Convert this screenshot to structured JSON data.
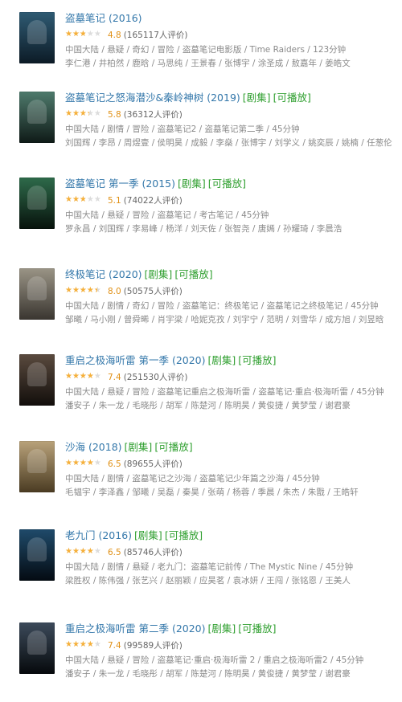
{
  "colors": {
    "link": "#3377aa",
    "tag_green": "#2f9f2f",
    "star": "#f6b03a",
    "score": "#e09015",
    "meta": "#8a8a8a"
  },
  "items": [
    {
      "title": "盗墓笔记 (2016)",
      "tags": [],
      "rating": 4.8,
      "votes": "(165117人评价)",
      "genres": "中国大陆 / 悬疑 / 奇幻 / 冒险 / 盗墓笔记电影版 / Time Raiders / 123分钟",
      "cast": "李仁港 / 井柏然 / 鹿晗 / 马思纯 / 王景春 / 张博宇 / 涂圣成 / 敖嘉年 / 姜皓文",
      "poster_colors": [
        "#2f5b73",
        "#0c1b26"
      ]
    },
    {
      "title": "盗墓笔记之怒海潜沙&秦岭神树 (2019)",
      "tags": [
        "[剧集]",
        "[可播放]"
      ],
      "rating": 5.8,
      "votes": "(36312人评价)",
      "genres": "中国大陆 / 剧情 / 冒险 / 盗墓笔记2 / 盗墓笔记第二季 / 45分钟",
      "cast": "刘国辉 / 李昂 / 周煜壹 / 侯明昊 / 成毅 / 李燊 / 张博宇 / 刘学义 / 姚奕辰 / 姚楠 / 任葱伦",
      "poster_colors": [
        "#4e7a6c",
        "#0f1a17"
      ]
    },
    {
      "title": "盗墓笔记 第一季 (2015)",
      "tags": [
        "[剧集]",
        "[可播放]"
      ],
      "rating": 5.1,
      "votes": "(74022人评价)",
      "genres": "中国大陆 / 悬疑 / 冒险 / 盗墓笔记 / 考古笔记 / 45分钟",
      "cast": "罗永昌 / 刘国辉 / 李易峰 / 杨洋 / 刘天佐 / 张智尧 / 唐嫣 / 孙耀琦 / 李晨浩",
      "poster_colors": [
        "#2e6a4a",
        "#07120c"
      ]
    },
    {
      "title": "终极笔记 (2020)",
      "tags": [
        "[剧集]",
        "[可播放]"
      ],
      "rating": 8.0,
      "votes": "(50575人评价)",
      "genres": "中国大陆 / 剧情 / 奇幻 / 冒险 / 盗墓笔记：终极笔记 / 盗墓笔记之终极笔记 / 45分钟",
      "cast": "邹曦 / 马小刚 / 曾舜晞 / 肖宇梁 / 哈妮克孜 / 刘宇宁 / 范明 / 刘雪华 / 成方旭 / 刘昱晗",
      "poster_colors": [
        "#9a9486",
        "#3a3630"
      ]
    },
    {
      "title": "重启之极海听雷 第一季 (2020)",
      "tags": [
        "[剧集]",
        "[可播放]"
      ],
      "rating": 7.4,
      "votes": "(251530人评价)",
      "genres": "中国大陆 / 悬疑 / 冒险 / 盗墓笔记重启之极海听雷 / 盗墓笔记·重启·极海听雷 / 45分钟",
      "cast": "潘安子 / 朱一龙 / 毛晓彤 / 胡军 / 陈楚河 / 陈明昊 / 黄俊捷 / 黄梦莹 / 谢君豪",
      "poster_colors": [
        "#5a4a3e",
        "#120e0b"
      ]
    },
    {
      "title": "沙海 (2018)",
      "tags": [
        "[剧集]",
        "[可播放]"
      ],
      "rating": 6.5,
      "votes": "(89655人评价)",
      "genres": "中国大陆 / 剧情 / 盗墓笔记之沙海 / 盗墓笔记少年篇之沙海 / 45分钟",
      "cast": "毛韫宇 / 李泽鑫 / 邹曦 / 吴磊 / 秦昊 / 张萌 / 杨蓉 / 季晨 / 朱杰 / 朱戬 / 王皓轩",
      "poster_colors": [
        "#b9a27a",
        "#4a3b22"
      ]
    },
    {
      "title": "老九门 (2016)",
      "tags": [
        "[剧集]",
        "[可播放]"
      ],
      "rating": 6.5,
      "votes": "(85746人评价)",
      "genres": "中国大陆 / 剧情 / 悬疑 / 老九门：盗墓笔记前传 / The Mystic Nine / 45分钟",
      "cast": "梁胜权 / 陈伟强 / 张艺兴 / 赵丽颖 / 应昊茗 / 袁冰妍 / 王闯 / 张铭恩 / 王美人",
      "poster_colors": [
        "#1f4a6a",
        "#040b12"
      ]
    },
    {
      "title": "重启之极海听雷 第二季 (2020)",
      "tags": [
        "[剧集]",
        "[可播放]"
      ],
      "rating": 7.4,
      "votes": "(99589人评价)",
      "genres": "中国大陆 / 悬疑 / 冒险 / 盗墓笔记·重启·极海听雷 2 / 重启之极海听雷2 / 45分钟",
      "cast": "潘安子 / 朱一龙 / 毛晓彤 / 胡军 / 陈楚河 / 陈明昊 / 黄俊捷 / 黄梦莹 / 谢君豪",
      "poster_colors": [
        "#3c4a5a",
        "#06090c"
      ]
    }
  ]
}
